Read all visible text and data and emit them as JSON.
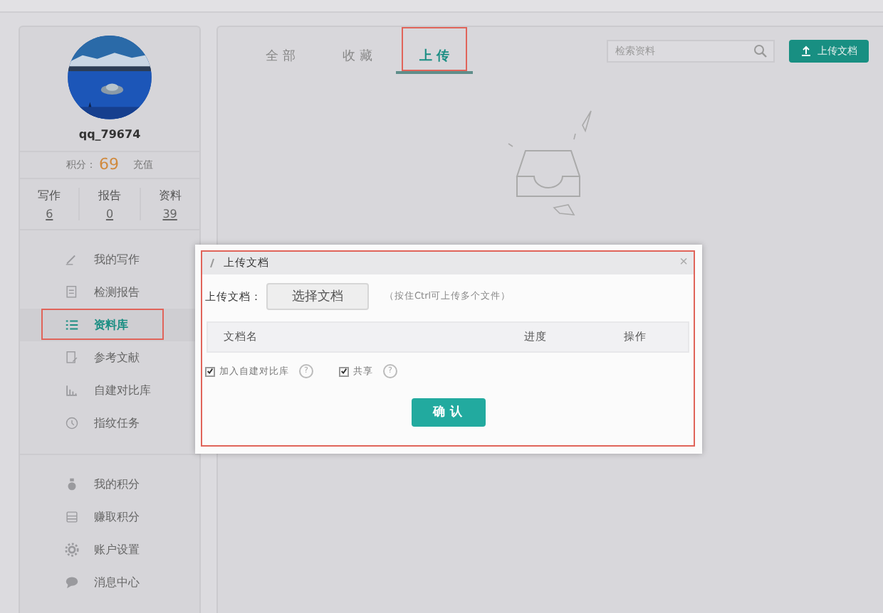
{
  "user": {
    "name": "qq_79674",
    "points_label": "积分：",
    "points": "69",
    "recharge": "充值"
  },
  "stats": [
    {
      "label": "写作",
      "value": "6"
    },
    {
      "label": "报告",
      "value": "0"
    },
    {
      "label": "资料",
      "value": "39"
    }
  ],
  "menu": [
    {
      "label": "我的写作",
      "selected": false
    },
    {
      "label": "检测报告",
      "selected": false
    },
    {
      "label": "资料库",
      "selected": true
    },
    {
      "label": "参考文献",
      "selected": false
    },
    {
      "label": "自建对比库",
      "selected": false
    },
    {
      "label": "指纹任务",
      "selected": false
    }
  ],
  "menu2": [
    {
      "label": "我的积分",
      "selected": false
    },
    {
      "label": "赚取积分",
      "selected": false
    },
    {
      "label": "账户设置",
      "selected": false
    },
    {
      "label": "消息中心",
      "selected": false
    }
  ],
  "tabs": [
    {
      "label": "全 部",
      "selected": false
    },
    {
      "label": "收 藏",
      "selected": false
    },
    {
      "label": "上 传",
      "selected": true
    }
  ],
  "search": {
    "placeholder": "检索资料"
  },
  "upload_button": "上传文档",
  "dialog": {
    "title": "上传文档",
    "close": "×",
    "field_label": "上传文档：",
    "choose_button": "选择文档",
    "hint": "（按住Ctrl可上传多个文件）",
    "columns": [
      "文档名",
      "进度",
      "操作"
    ],
    "options": [
      {
        "label": "加入自建对比库",
        "checked": true,
        "help": "?"
      },
      {
        "label": "共享",
        "checked": true,
        "help": "?"
      }
    ],
    "confirm": "确 认"
  }
}
